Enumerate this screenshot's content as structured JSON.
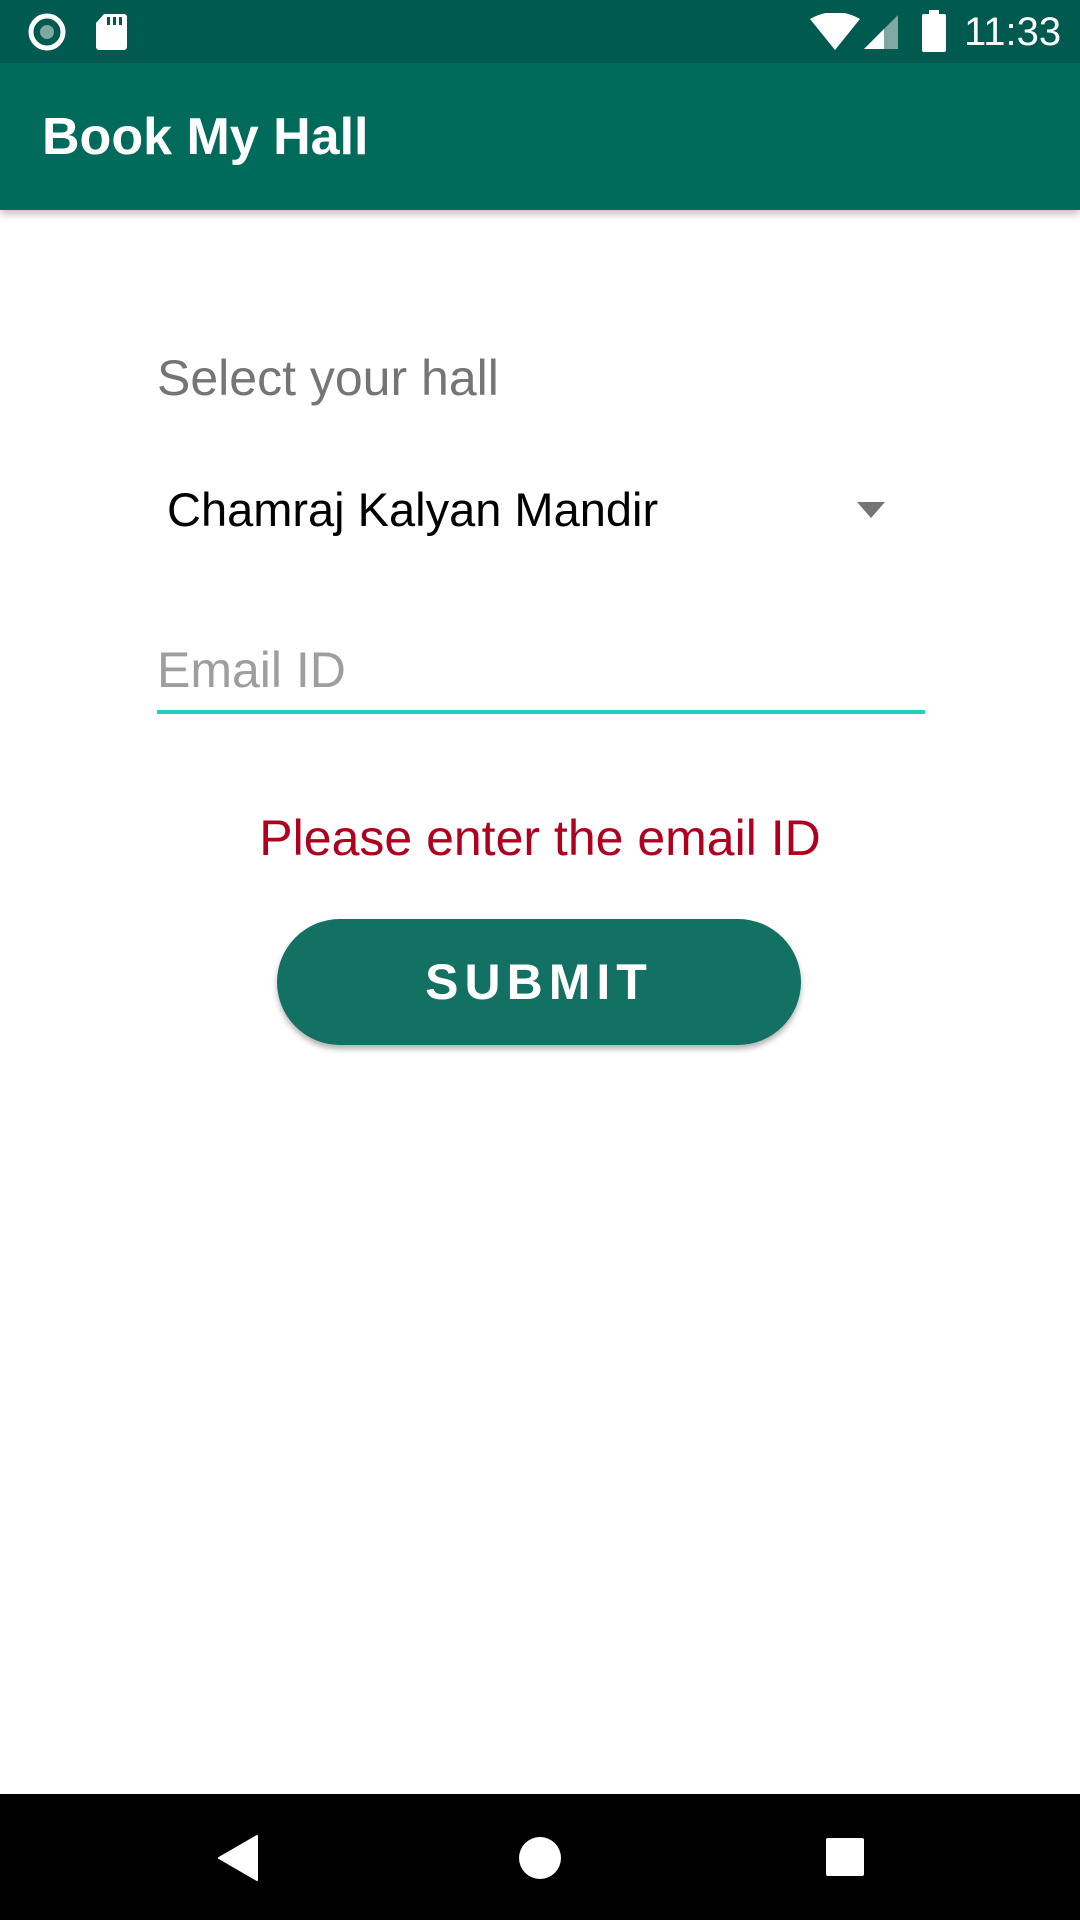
{
  "status_bar": {
    "time": "11:33",
    "icons": [
      "record-icon",
      "sd-card-icon",
      "wifi-icon",
      "cellular-signal-icon",
      "battery-icon"
    ]
  },
  "app_bar": {
    "title": "Book My Hall",
    "background": "#006b5a"
  },
  "form": {
    "select_label": "Select your hall",
    "hall_spinner": {
      "selected": "Chamraj Kalyan Mandir"
    },
    "email_field": {
      "value": "",
      "placeholder": "Email ID"
    },
    "error_message": "Please enter the email ID",
    "submit_label": "SUBMIT"
  },
  "nav_bar": {
    "icons": [
      "back-icon",
      "home-icon",
      "recents-icon"
    ]
  },
  "colors": {
    "status_bar": "#005a4f",
    "primary": "#006b5a",
    "accent": "#1fcfbf",
    "button": "#137163",
    "error": "#b00020"
  }
}
